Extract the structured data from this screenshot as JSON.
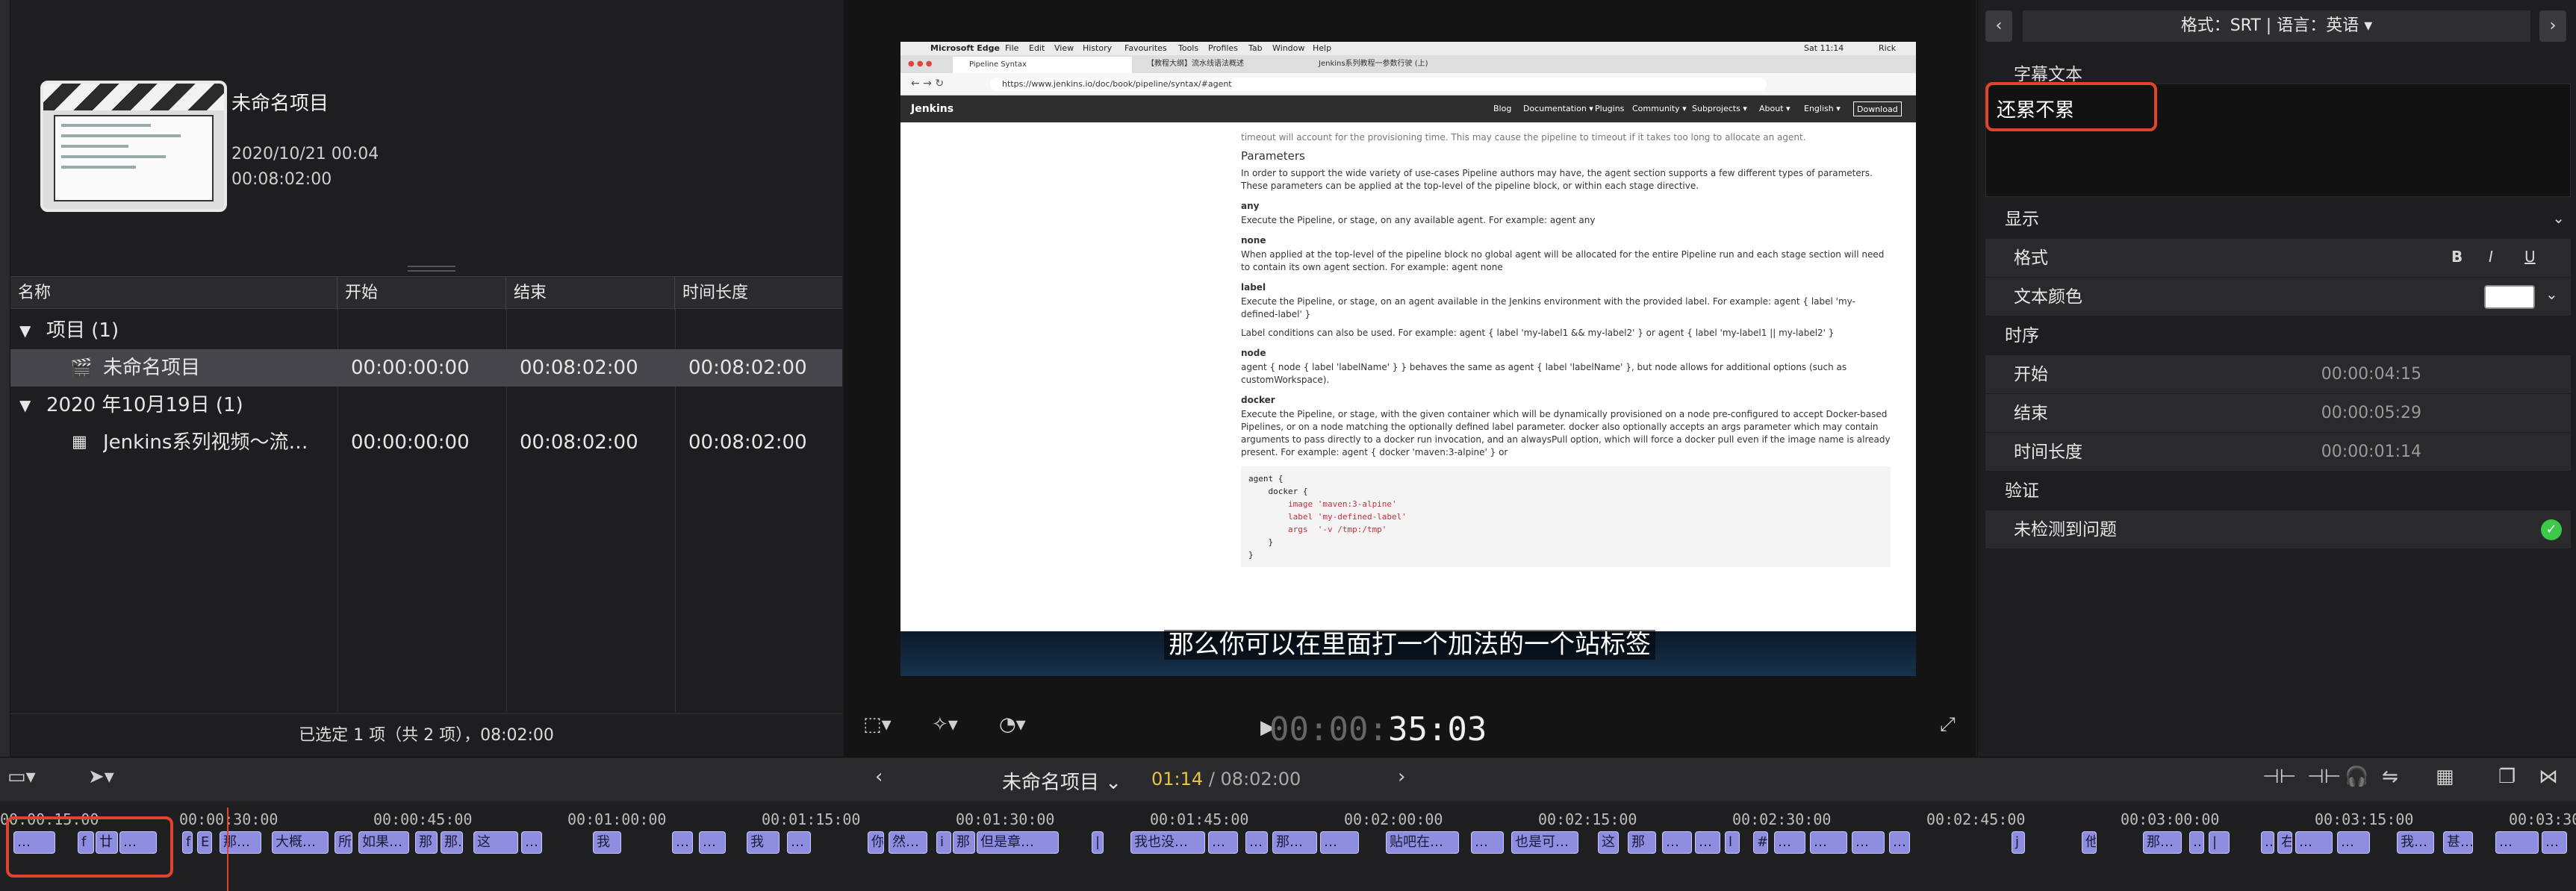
{
  "browser": {
    "project_title": "未命名项目",
    "project_date": "2020/10/21 00:04",
    "project_duration": "00:08:02:00",
    "columns": [
      "名称",
      "开始",
      "结束",
      "时间长度"
    ],
    "rows": [
      {
        "name": "项目  (1)",
        "start": "",
        "end": "",
        "duration": "",
        "kind": "group"
      },
      {
        "name": "未命名项目",
        "start": "00:00:00:00",
        "end": "00:08:02:00",
        "duration": "00:08:02:00",
        "kind": "project"
      },
      {
        "name": "2020 年10月19日  (1)",
        "start": "",
        "end": "",
        "duration": "",
        "kind": "group"
      },
      {
        "name": "Jenkins系列视频～流…",
        "start": "00:00:00:00",
        "end": "00:08:02:00",
        "duration": "00:08:02:00",
        "kind": "clip"
      }
    ],
    "status": "已选定 1 项（共 2 项），08:02:00"
  },
  "viewer": {
    "subtitle": "那么你可以在里面打一个加法的一个站标签",
    "timecode_dim": "00:00:",
    "timecode": "35:03",
    "web": {
      "menubar": [
        "Microsoft Edge",
        "File",
        "Edit",
        "View",
        "History",
        "Favourites",
        "Tools",
        "Profiles",
        "Tab",
        "Window",
        "Help"
      ],
      "clock": "Sat 11:14",
      "user": "Rick",
      "tabs": [
        "Pipeline Syntax",
        "【教程大纲】流水线语法概述",
        "Jenkins系列教程一参数行驶 (上)"
      ],
      "url": "https://www.jenkins.io/doc/book/pipeline/syntax/#agent",
      "brand": "Jenkins",
      "nav": [
        "Blog",
        "Documentation ▾",
        "Plugins",
        "Community ▾",
        "Subprojects ▾",
        "About ▾",
        "English ▾",
        "Download"
      ],
      "intro": "timeout will account for the provisioning time. This may cause the pipeline to timeout if it takes too long to allocate an agent.",
      "heading": "Parameters",
      "para": "In order to support the wide variety of use-cases Pipeline authors may have, the agent section supports a few different types of parameters. These parameters can be applied at the top-level of the pipeline block, or within each stage directive.",
      "sections": [
        {
          "h": "any",
          "t": "Execute the Pipeline, or stage, on any available agent. For example: agent any"
        },
        {
          "h": "none",
          "t": "When applied at the top-level of the pipeline block no global agent will be allocated for the entire Pipeline run and each stage section will need to contain its own agent section. For example: agent none"
        },
        {
          "h": "label",
          "t": "Execute the Pipeline, or stage, on an agent available in the Jenkins environment with the provided label. For example: agent { label 'my-defined-label' }"
        },
        {
          "h": "",
          "t": "Label conditions can also be used. For example: agent { label 'my-label1 && my-label2' } or agent { label 'my-label1 || my-label2' }"
        },
        {
          "h": "node",
          "t": "agent { node { label 'labelName' } } behaves the same as agent { label 'labelName' }, but node allows for additional options (such as customWorkspace)."
        },
        {
          "h": "docker",
          "t": "Execute the Pipeline, or stage, with the given container which will be dynamically provisioned on a node pre-configured to accept Docker-based Pipelines, or on a node matching the optionally defined label parameter. docker also optionally accepts an args parameter which may contain arguments to pass directly to a docker run invocation, and an alwaysPull option, which will force a docker pull even if the image name is already present. For example: agent { docker 'maven:3-alpine' } or"
        }
      ],
      "code": [
        "agent {",
        "    docker {",
        "        image 'maven:3-alpine'",
        "        label 'my-defined-label'",
        "        args  '-v /tmp:/tmp'",
        "    }",
        "}"
      ]
    }
  },
  "inspector": {
    "header": "格式：SRT | 语言：英语",
    "text_label": "字幕文本",
    "text_value": "还累不累",
    "display": "显示",
    "format": "格式",
    "format_buttons": [
      "B",
      "I",
      "U"
    ],
    "text_color_label": "文本颜色",
    "text_color": "#ffffff",
    "timing": "时序",
    "start_label": "开始",
    "start": "00:00:04:15",
    "end_label": "结束",
    "end": "00:00:05:29",
    "duration_label": "时间长度",
    "duration": "00:00:01:14",
    "verify": "验证",
    "verify_status": "未检测到问题",
    "ok_color": "#3cc94a"
  },
  "timeline": {
    "project": "未命名项目",
    "position": "01:14",
    "total": "/ 08:02:00",
    "ruler": [
      "00:00:15:00",
      "00:00:30:00",
      "00:00:45:00",
      "00:01:00:00",
      "00:01:15:00",
      "00:01:30:00",
      "00:01:45:00",
      "00:02:00:00",
      "00:02:15:00",
      "00:02:30:00",
      "00:02:45:00",
      "00:03:00:00",
      "00:03:15:00",
      "00:03:30"
    ],
    "clips": [
      "…",
      "f",
      "廿",
      "…",
      "f",
      "E",
      "那…",
      "大概…",
      "所",
      "如果…",
      "那",
      "那…",
      "这",
      "…",
      "我",
      "…",
      "…",
      "我",
      "…",
      "你",
      "然…",
      "i",
      "那",
      "但是章…",
      "|",
      "我也没…",
      "…",
      "…",
      "那…",
      "…",
      "贴吧在…",
      "…",
      "也是可…",
      "这",
      "那",
      "…",
      "…",
      "l",
      "#",
      "…",
      "…",
      "…",
      "…",
      "j",
      "他",
      "那…",
      "…",
      "|",
      "…",
      "右",
      "…",
      "…",
      "我…",
      "甚…",
      "…",
      "…"
    ]
  }
}
